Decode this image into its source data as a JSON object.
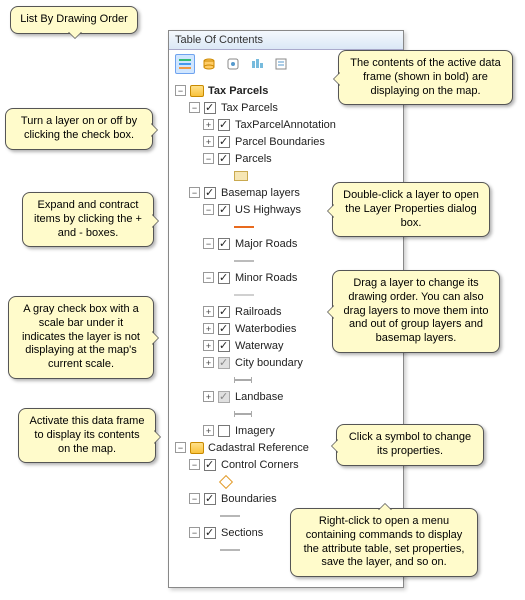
{
  "window": {
    "title": "Table Of Contents"
  },
  "toolbar": {
    "buttons": [
      "list-by-drawing-order",
      "list-by-source",
      "list-by-visibility",
      "list-by-selection",
      "options"
    ]
  },
  "tree": {
    "dataframes": [
      {
        "name": "Tax Parcels",
        "bold": true,
        "groups": [
          {
            "name": "Tax Parcels",
            "checked": true,
            "expand": "-",
            "children": [
              {
                "name": "TaxParcelAnnotation",
                "checked": true,
                "expand": "+"
              },
              {
                "name": "Parcel Boundaries",
                "checked": true,
                "expand": "+"
              },
              {
                "name": "Parcels",
                "checked": true,
                "expand": "-",
                "sym": {
                  "type": "box",
                  "fill": "#F6E6B4",
                  "stroke": "#C9A94F"
                }
              }
            ]
          },
          {
            "name": "Basemap layers",
            "checked": true,
            "expand": "-",
            "children": [
              {
                "name": "US Highways",
                "checked": true,
                "expand": "-",
                "sym": {
                  "type": "line",
                  "color": "#E86A1E"
                }
              },
              {
                "name": "Major Roads",
                "checked": true,
                "expand": "-",
                "sym": {
                  "type": "line",
                  "color": "#BCBCBC"
                }
              },
              {
                "name": "Minor Roads",
                "checked": true,
                "expand": "-",
                "sym": {
                  "type": "line",
                  "color": "#D0D0D0"
                }
              },
              {
                "name": "Railroads",
                "checked": true,
                "expand": "+"
              },
              {
                "name": "Waterbodies",
                "checked": true,
                "expand": "+"
              },
              {
                "name": "Waterway",
                "checked": true,
                "expand": "+"
              },
              {
                "name": "City boundary",
                "checked": "gray",
                "expand": "+",
                "scalebar": true
              },
              {
                "name": "Landbase",
                "checked": "gray",
                "expand": "+",
                "scalebar": true
              },
              {
                "name": "Imagery",
                "checked": false,
                "expand": "+"
              }
            ]
          }
        ]
      },
      {
        "name": "Cadastral Reference",
        "bold": false,
        "groups": [
          {
            "name": "Control Corners",
            "checked": true,
            "expand": "-",
            "sym": {
              "type": "marker",
              "color": "#E29B2A"
            }
          },
          {
            "name": "Boundaries",
            "checked": true,
            "expand": "-",
            "sym": {
              "type": "line",
              "color": "#B7B7B7"
            }
          },
          {
            "name": "Sections",
            "checked": true,
            "expand": "-",
            "sym": {
              "type": "line",
              "color": "#B7B7B7"
            }
          }
        ]
      }
    ]
  },
  "callouts": {
    "c1": "List By Drawing Order",
    "c2": "The contents of the active data frame (shown in bold) are displaying on the map.",
    "c3": "Turn a layer on or off by clicking the check box.",
    "c4": "Expand and contract items by clicking the + and - boxes.",
    "c5": "Double-click a layer to open the Layer Properties dialog box.",
    "c6": "Drag a layer to change its drawing order. You can also drag layers to move them into and out of group layers and basemap layers.",
    "c7": "A gray check box with a scale bar under it indicates the layer is not displaying at the map's current scale.",
    "c8": "Activate this data frame to display its contents on the map.",
    "c9": "Click a symbol to change its properties.",
    "c10": "Right-click to open a menu containing commands to display the attribute table, set properties, save the layer, and so on."
  }
}
